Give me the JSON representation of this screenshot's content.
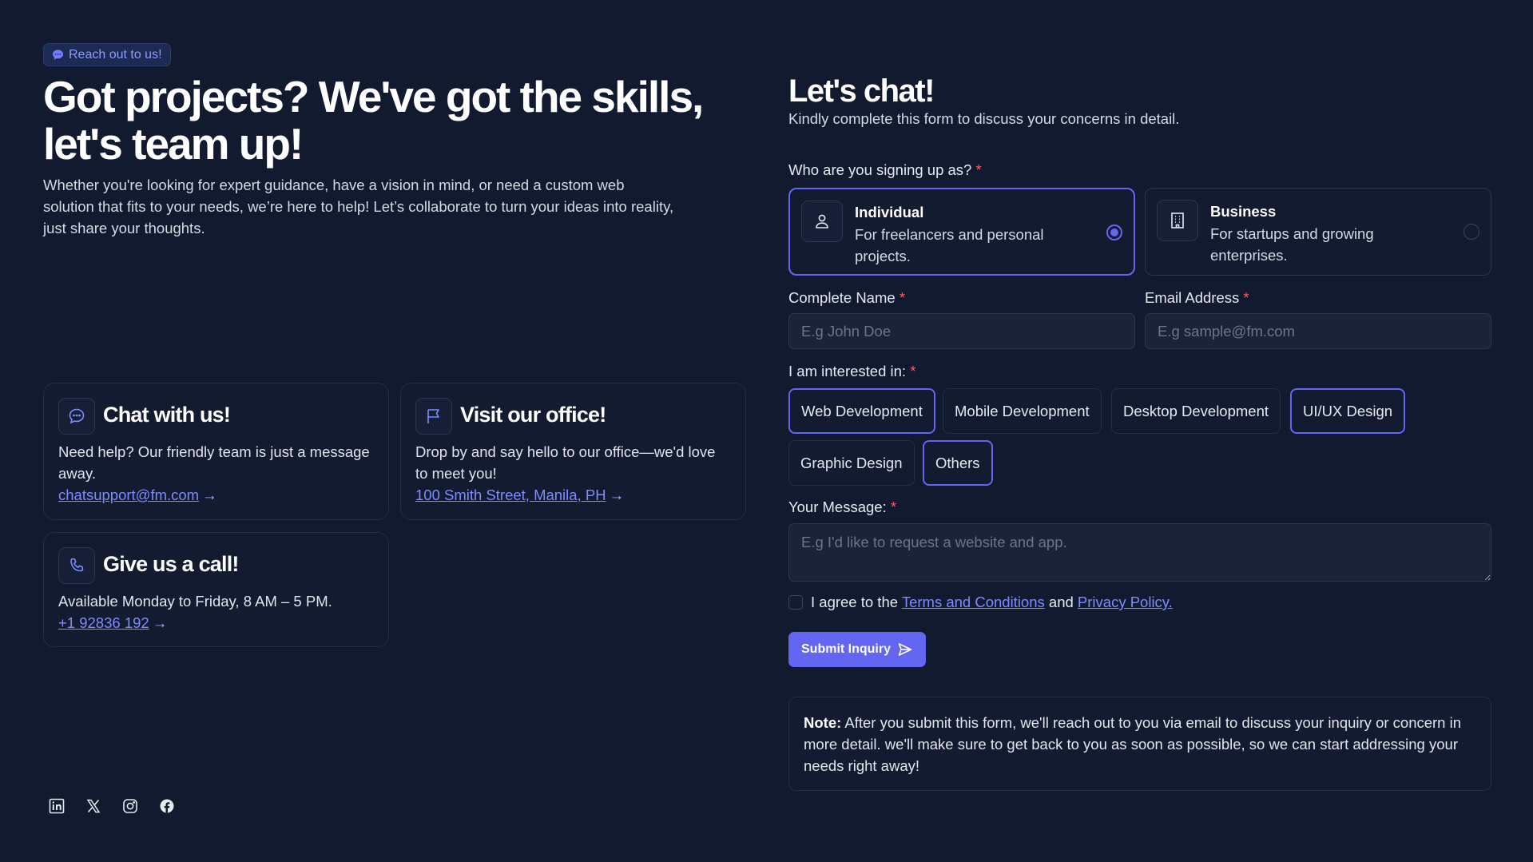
{
  "badge": {
    "label": "Reach out to us!"
  },
  "hero": {
    "title_line1": "Got projects? We've got the skills,",
    "title_line2": "let's team up!",
    "description": "Whether you're looking for expert guidance, have a vision in mind, or need a custom web solution that fits to your needs, we’re here to help! Let’s collaborate to turn your ideas into reality, just share your thoughts."
  },
  "cards": {
    "chat": {
      "title": "Chat with us!",
      "text": "Need help? Our friendly team is just a message away.",
      "link": "chatsupport@fm.com",
      "arrow": "→"
    },
    "office": {
      "title": "Visit our office!",
      "text": "Drop by and say hello to our office—we'd love to meet you!",
      "link": "100 Smith Street, Manila, PH",
      "arrow": "→"
    },
    "call": {
      "title": "Give us a call!",
      "text": "Available Monday to Friday, 8 AM – 5 PM.",
      "link": "+1 92836 192",
      "arrow": "→"
    }
  },
  "socials": [
    "linkedin-icon",
    "x-icon",
    "instagram-icon",
    "facebook-icon"
  ],
  "form": {
    "title": "Let's chat!",
    "subtitle": "Kindly complete this form to discuss your concerns in detail.",
    "required_mark": "*",
    "role_label": "Who are you signing up as?",
    "roles": [
      {
        "title": "Individual",
        "desc": "For freelancers and personal projects.",
        "selected": true
      },
      {
        "title": "Business",
        "desc": "For startups and growing enterprises.",
        "selected": false
      }
    ],
    "name_label": "Complete Name",
    "name_placeholder": "E.g John Doe",
    "email_label": "Email Address",
    "email_placeholder": "E.g sample@fm.com",
    "interest_label": "I am interested in:",
    "interests": [
      {
        "label": "Web Development",
        "active": true
      },
      {
        "label": "Mobile Development",
        "active": false
      },
      {
        "label": "Desktop Development",
        "active": false
      },
      {
        "label": "UI/UX Design",
        "active": true
      },
      {
        "label": "Graphic Design",
        "active": false
      },
      {
        "label": "Others",
        "active": true
      }
    ],
    "message_label": "Your Message:",
    "message_placeholder": "E.g I'd like to request a website and app.",
    "agree_prefix": "I agree to the",
    "terms_link": "Terms and Conditions",
    "agree_and": "and",
    "privacy_link": "Privacy Policy.",
    "submit_label": "Submit Inquiry",
    "note_bold": "Note:",
    "note_text": " After you submit this form, we'll reach out to you via email to discuss your inquiry or concern in more detail. we'll make sure to get back to you as soon as possible, so we can start addressing your needs right away!"
  },
  "colors": {
    "background": "#111a2e",
    "accent": "#6366f1",
    "link": "#7f8cff",
    "required": "#ff5a5a"
  }
}
